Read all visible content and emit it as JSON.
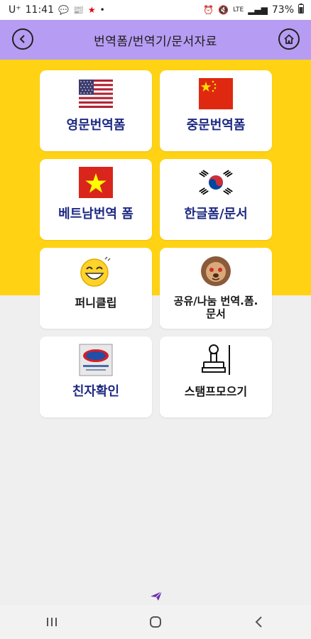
{
  "status_bar": {
    "carrier": "U⁺",
    "time": "11:41",
    "battery": "73%",
    "signal_label": "LTE"
  },
  "appbar": {
    "title": "번역폼/번역기/문서자료",
    "back_icon": "back-arrow-icon",
    "home_icon": "home-icon"
  },
  "cards": [
    {
      "label": "영문번역폼",
      "icon": "us-flag-icon"
    },
    {
      "label": "중문번역폼",
      "icon": "china-flag-icon"
    },
    {
      "label": "베트남번역 폼",
      "icon": "vietnam-flag-icon"
    },
    {
      "label": "한글폼/문서",
      "icon": "korea-flag-icon"
    },
    {
      "label": "퍼니클립",
      "icon": "laughing-face-icon"
    },
    {
      "label": "공유/나눔 번역.폼.\n문서",
      "icon": "lion-face-icon"
    },
    {
      "label": "친자확인",
      "icon": "certificate-badge-icon"
    },
    {
      "label": "스탬프모으기",
      "icon": "stamp-icon"
    }
  ],
  "colors": {
    "appbar": "#b79cf3",
    "band": "#ffd314",
    "label_blue": "#1e2a83"
  }
}
